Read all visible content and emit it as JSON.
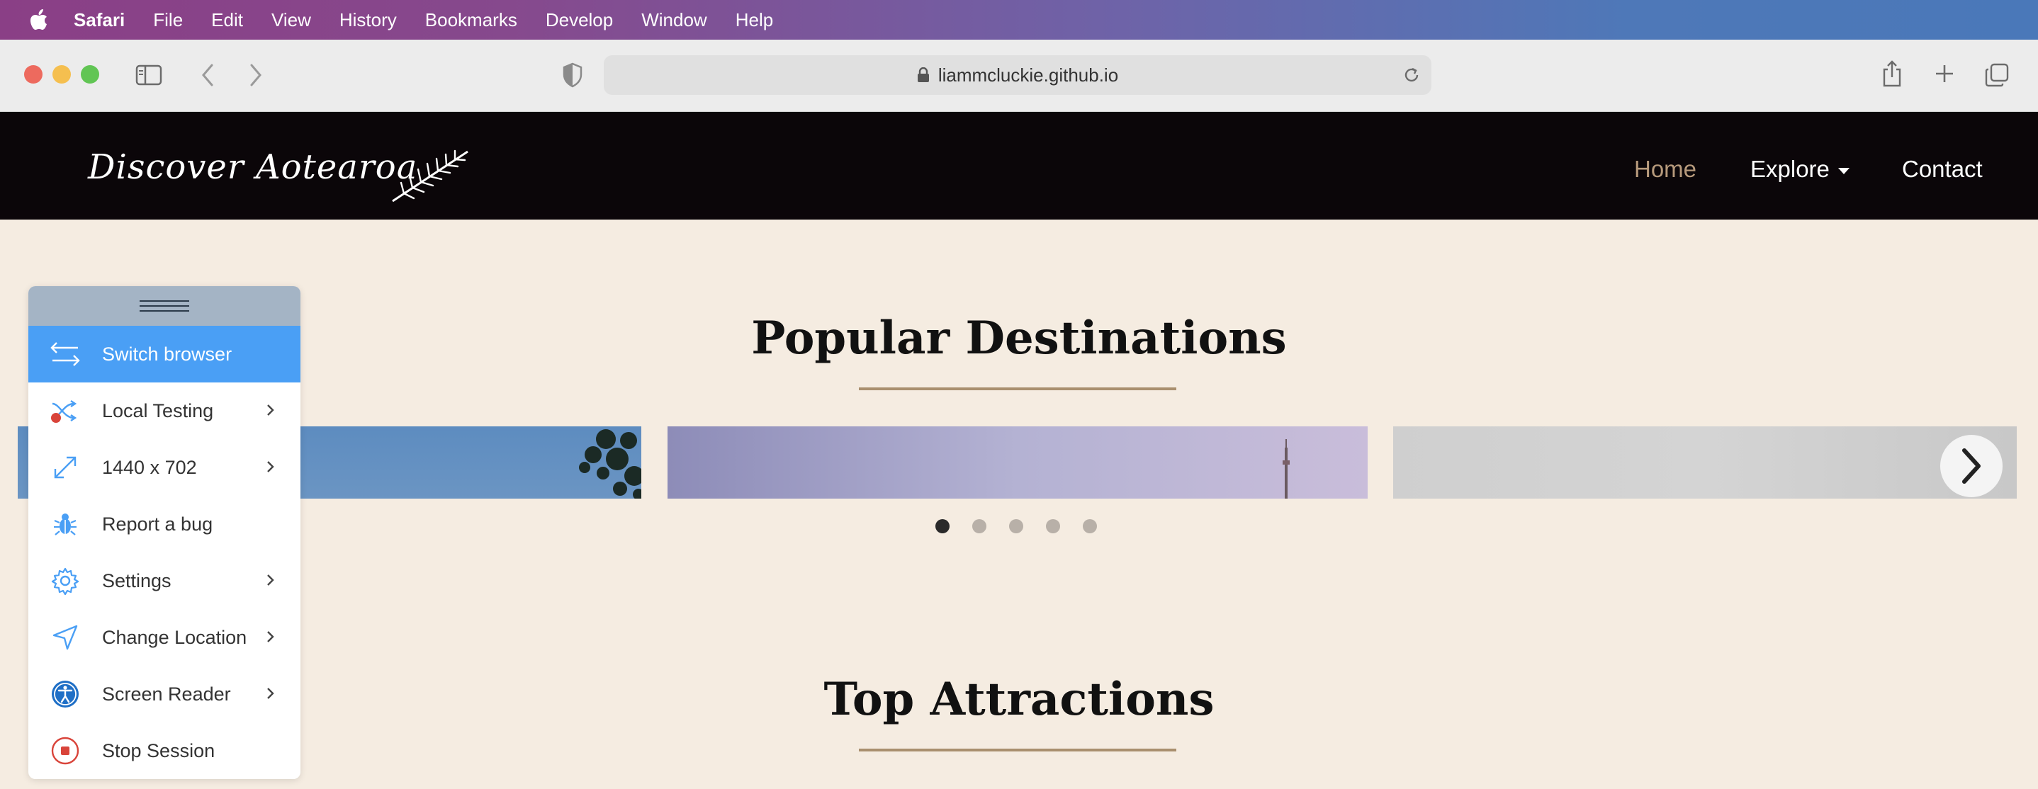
{
  "menubar": {
    "app": "Safari",
    "items": [
      "File",
      "Edit",
      "View",
      "History",
      "Bookmarks",
      "Develop",
      "Window",
      "Help"
    ]
  },
  "browser": {
    "url": "liammcluckie.github.io"
  },
  "site": {
    "brand": "Discover Aotearoa",
    "nav": {
      "home": "Home",
      "explore": "Explore",
      "contact": "Contact"
    },
    "sections": {
      "popular": "Popular Destinations",
      "attractions": "Top Attractions"
    },
    "carousel": {
      "dot_count": 5,
      "active_index": 0
    }
  },
  "panel": {
    "items": [
      {
        "label": "Switch browser",
        "icon": "switch-icon",
        "chevron": false
      },
      {
        "label": "Local Testing",
        "icon": "local-testing-icon",
        "chevron": true
      },
      {
        "label": "1440 x 702",
        "icon": "resize-icon",
        "chevron": true
      },
      {
        "label": "Report a bug",
        "icon": "bug-icon",
        "chevron": false
      },
      {
        "label": "Settings",
        "icon": "gear-icon",
        "chevron": true
      },
      {
        "label": "Change Location",
        "icon": "location-arrow-icon",
        "chevron": true
      },
      {
        "label": "Screen Reader",
        "icon": "accessibility-icon",
        "chevron": true
      },
      {
        "label": "Stop Session",
        "icon": "stop-icon",
        "chevron": false
      }
    ]
  },
  "colors": {
    "accent_blue": "#4a9ff5",
    "nav_active": "#b79a7c",
    "page_bg": "#f5ece1",
    "header_bg": "#0b0609"
  }
}
